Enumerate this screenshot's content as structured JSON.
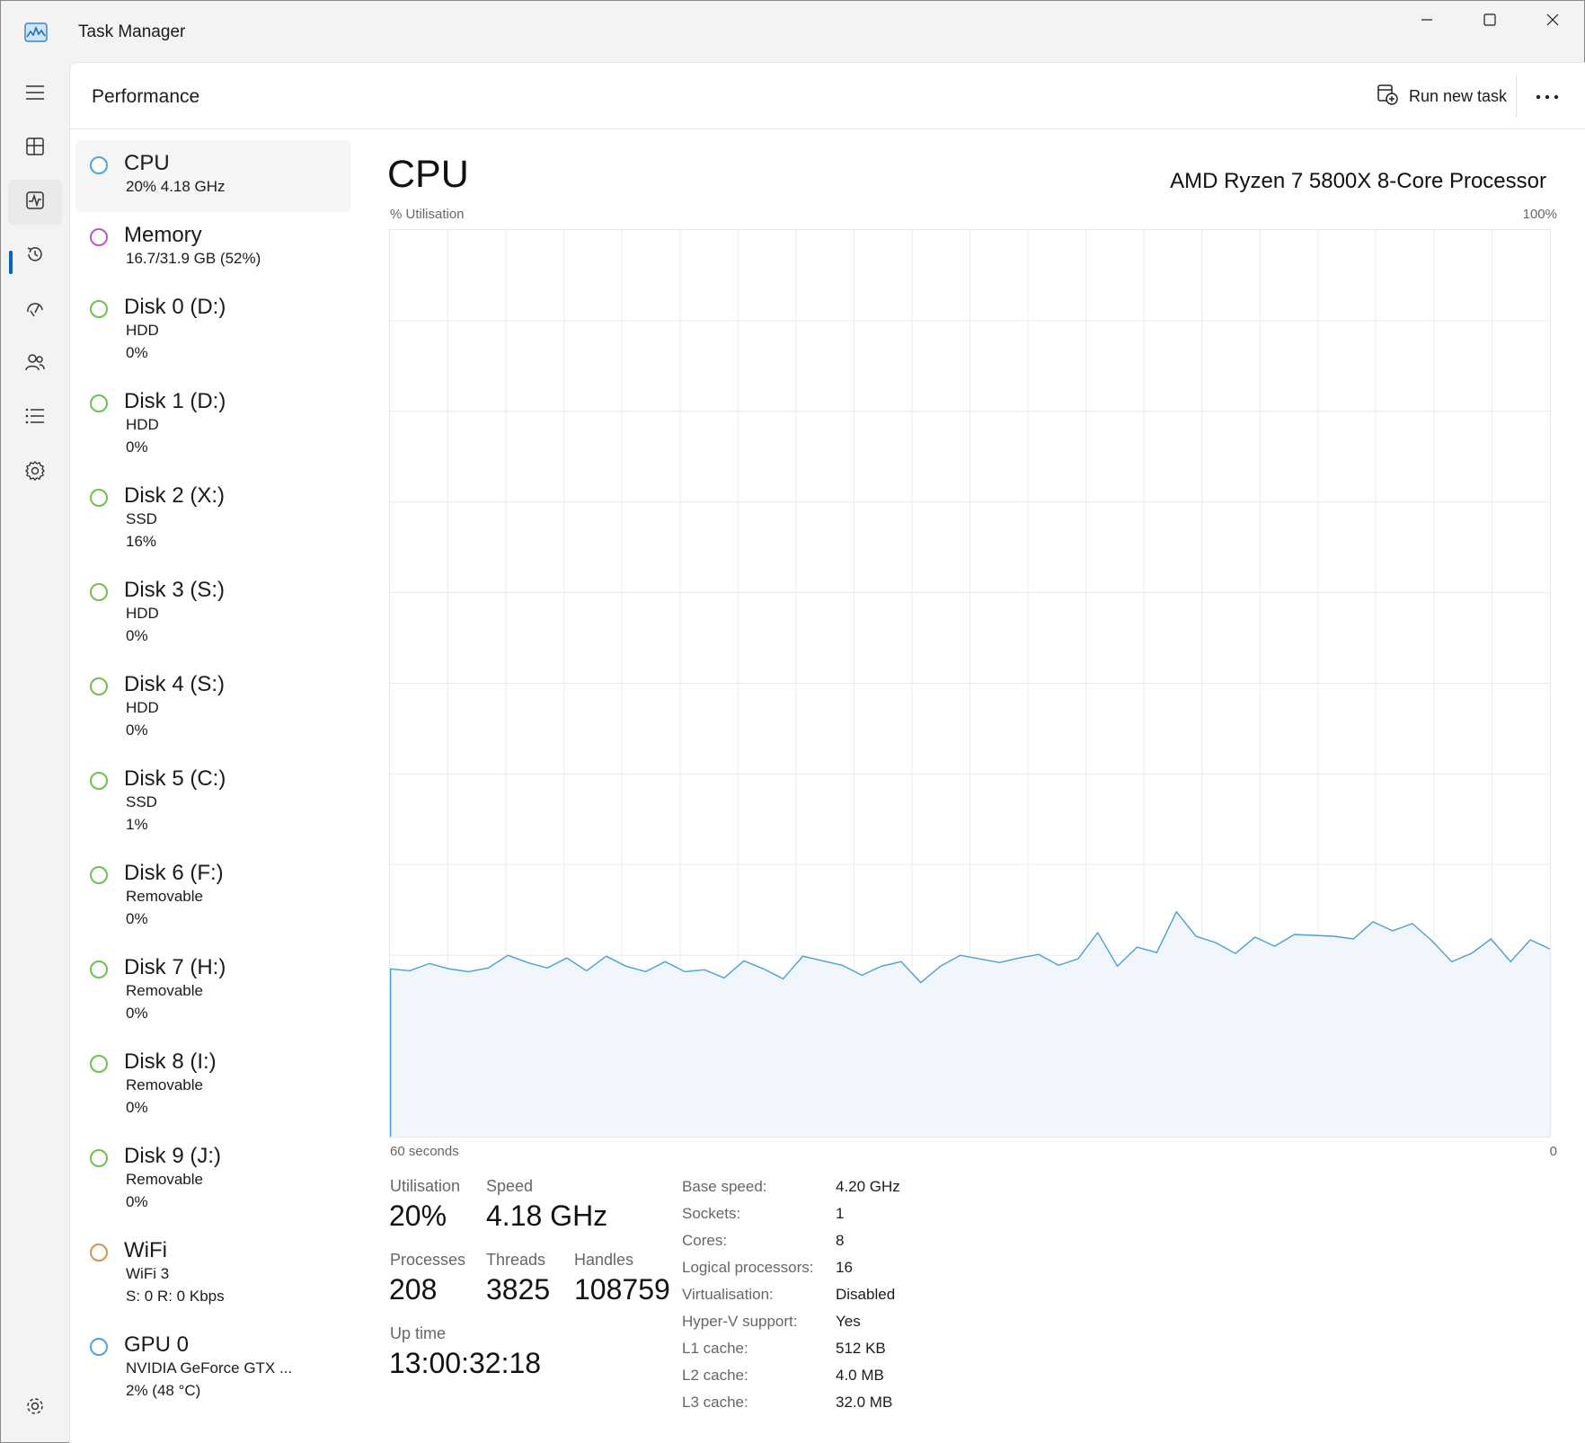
{
  "app": {
    "title": "Task Manager"
  },
  "window_controls": {
    "minimize": "minimize-icon",
    "maximize": "maximize-icon",
    "close": "close-icon"
  },
  "nav_rail": {
    "items": [
      {
        "name": "hamburger-icon"
      },
      {
        "name": "processes-icon"
      },
      {
        "name": "performance-icon",
        "active": true
      },
      {
        "name": "app-history-icon"
      },
      {
        "name": "startup-apps-icon"
      },
      {
        "name": "users-icon"
      },
      {
        "name": "details-icon"
      },
      {
        "name": "services-icon"
      },
      {
        "name": "settings-icon"
      }
    ],
    "accent": "#0067c0"
  },
  "header": {
    "title": "Performance",
    "run_task_label": "Run new task"
  },
  "resources": [
    {
      "name": "CPU",
      "lines": [
        "20%  4.18 GHz"
      ],
      "color": "#4fa3e0",
      "selected": true
    },
    {
      "name": "Memory",
      "lines": [
        "16.7/31.9 GB (52%)"
      ],
      "color": "#b05bc9"
    },
    {
      "name": "Disk 0 (D:)",
      "lines": [
        "HDD",
        "0%"
      ],
      "color": "#6cc24a"
    },
    {
      "name": "Disk 1 (D:)",
      "lines": [
        "HDD",
        "0%"
      ],
      "color": "#6cc24a"
    },
    {
      "name": "Disk 2 (X:)",
      "lines": [
        "SSD",
        "16%"
      ],
      "color": "#6cc24a"
    },
    {
      "name": "Disk 3 (S:)",
      "lines": [
        "HDD",
        "0%"
      ],
      "color": "#6cc24a"
    },
    {
      "name": "Disk 4 (S:)",
      "lines": [
        "HDD",
        "0%"
      ],
      "color": "#6cc24a"
    },
    {
      "name": "Disk 5 (C:)",
      "lines": [
        "SSD",
        "1%"
      ],
      "color": "#6cc24a"
    },
    {
      "name": "Disk 6 (F:)",
      "lines": [
        "Removable",
        "0%"
      ],
      "color": "#6cc24a"
    },
    {
      "name": "Disk 7 (H:)",
      "lines": [
        "Removable",
        "0%"
      ],
      "color": "#6cc24a"
    },
    {
      "name": "Disk 8 (I:)",
      "lines": [
        "Removable",
        "0%"
      ],
      "color": "#6cc24a"
    },
    {
      "name": "Disk 9 (J:)",
      "lines": [
        "Removable",
        "0%"
      ],
      "color": "#6cc24a"
    },
    {
      "name": "WiFi",
      "lines": [
        "WiFi 3",
        "S: 0  R: 0 Kbps"
      ],
      "color": "#d9904a"
    },
    {
      "name": "GPU 0",
      "lines": [
        "NVIDIA GeForce GTX ...",
        "2%  (48 °C)"
      ],
      "color": "#4fa3e0"
    }
  ],
  "cpu": {
    "title": "CPU",
    "model": "AMD Ryzen 7 5800X 8-Core Processor",
    "graph_label_left": "% Utilisation",
    "graph_label_right": "100%",
    "graph_bottom_left": "60 seconds",
    "graph_bottom_right": "0"
  },
  "chart_data": {
    "type": "area",
    "y_range": [
      0,
      100
    ],
    "values": [
      18.5,
      18.3,
      19.1,
      18.5,
      18.2,
      18.6,
      20,
      19.2,
      18.6,
      19.7,
      18.3,
      19.9,
      18.8,
      18.2,
      19.3,
      18.2,
      18.4,
      17.5,
      19.4,
      18.5,
      17.4,
      19.9,
      19.4,
      18.9,
      17.8,
      18.8,
      19.3,
      17,
      18.8,
      20,
      19.6,
      19.2,
      19.7,
      20.1,
      18.9,
      19.6,
      22.5,
      18.8,
      20.9,
      20.3,
      24.8,
      22.1,
      21.4,
      20.2,
      22,
      21,
      22.3,
      22.2,
      22.1,
      21.8,
      23.7,
      22.7,
      23.5,
      21.6,
      19.3,
      20.2,
      21.8,
      19.3,
      21.7,
      20.7
    ],
    "line_color": "#4a9fd5",
    "fill_color": "#f0f6fb",
    "grid_rows": 10,
    "grid_cols": 20
  },
  "stats": {
    "utilisation_label": "Utilisation",
    "utilisation": "20%",
    "speed_label": "Speed",
    "speed": "4.18 GHz",
    "processes_label": "Processes",
    "processes": "208",
    "threads_label": "Threads",
    "threads": "3825",
    "handles_label": "Handles",
    "handles": "108759",
    "uptime_label": "Up time",
    "uptime": "13:00:32:18"
  },
  "specs": [
    {
      "label": "Base speed:",
      "value": "4.20 GHz"
    },
    {
      "label": "Sockets:",
      "value": "1"
    },
    {
      "label": "Cores:",
      "value": "8"
    },
    {
      "label": "Logical processors:",
      "value": "16"
    },
    {
      "label": "Virtualisation:",
      "value": "Disabled"
    },
    {
      "label": "Hyper-V support:",
      "value": "Yes"
    },
    {
      "label": "L1 cache:",
      "value": "512 KB"
    },
    {
      "label": "L2 cache:",
      "value": "4.0 MB"
    },
    {
      "label": "L3 cache:",
      "value": "32.0 MB"
    }
  ]
}
